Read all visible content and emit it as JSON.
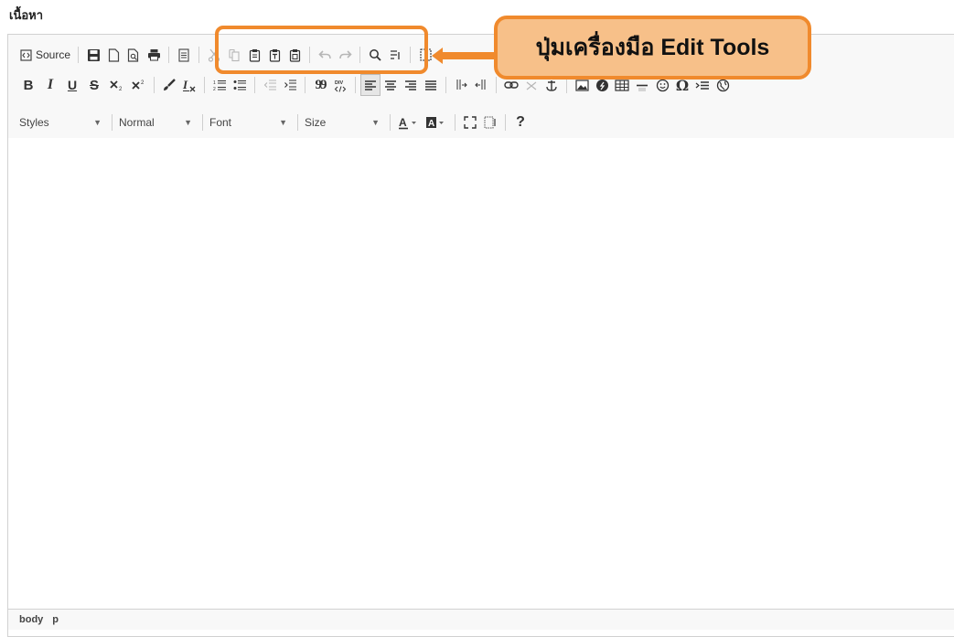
{
  "field_label": "เนื้อหา",
  "toolbar": {
    "source_label": "Source",
    "styles_label": "Styles",
    "format_label": "Normal",
    "font_label": "Font",
    "size_label": "Size",
    "help_label": "?",
    "bold_label": "B",
    "italic_label": "I",
    "underline_label": "U",
    "strike_label": "S",
    "omega_label": "Ω",
    "quote_label": "99"
  },
  "callout": {
    "text": "ปุ่มเครื่องมือ Edit Tools",
    "border_color": "#f08a2d",
    "fill_color": "#f7c089"
  },
  "status_path": [
    "body",
    "p"
  ]
}
